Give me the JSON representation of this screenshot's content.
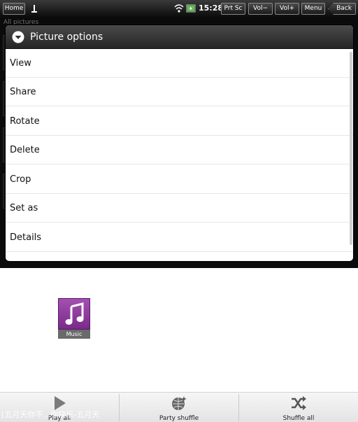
{
  "status_bar": {
    "home_label": "Home",
    "time": "15:28",
    "prt_sc_label": "Prt Sc",
    "vol_down_label": "Vol−",
    "vol_up_label": "Vol+",
    "menu_label": "Menu",
    "back_label": "Back",
    "icons": [
      "usb-icon",
      "wifi-icon",
      "battery-icon"
    ]
  },
  "background": {
    "breadcrumb": "All pictures"
  },
  "dialog": {
    "title": "Picture options",
    "title_icon": "chevron-down-circle-icon",
    "items": [
      {
        "label": "View"
      },
      {
        "label": "Share"
      },
      {
        "label": "Rotate"
      },
      {
        "label": "Delete"
      },
      {
        "label": "Crop"
      },
      {
        "label": "Set as"
      },
      {
        "label": "Details"
      }
    ]
  },
  "shortcut": {
    "label": "Music",
    "icon": "music-note-icon"
  },
  "bottom_bar": {
    "play_all": "Play all",
    "party_shuffle": "Party shuffle",
    "shuffle_all": "Shuffle all",
    "now_playing": "[五月天你不…你快乐-五月天"
  },
  "colors": {
    "dialog_header": "#333333",
    "music_tile": "#8e3c9e",
    "bottom_bar": "#eeeeee"
  }
}
